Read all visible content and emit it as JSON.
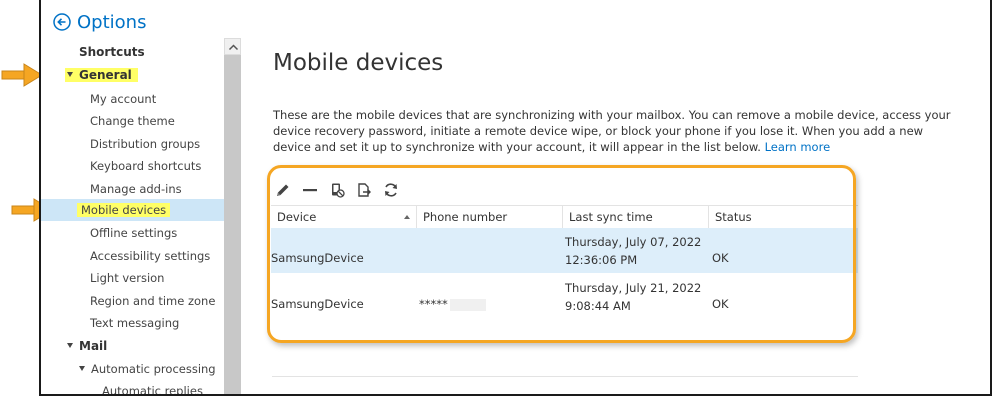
{
  "header": {
    "title": "Options"
  },
  "sidebar": {
    "items": [
      {
        "label": "Shortcuts",
        "kind": "category"
      },
      {
        "label": "General",
        "kind": "category-expanded"
      },
      {
        "label": "My account",
        "kind": "sub"
      },
      {
        "label": "Change theme",
        "kind": "sub"
      },
      {
        "label": "Distribution groups",
        "kind": "sub"
      },
      {
        "label": "Keyboard shortcuts",
        "kind": "sub"
      },
      {
        "label": "Manage add-ins",
        "kind": "sub"
      },
      {
        "label": "Mobile devices",
        "kind": "sub-selected"
      },
      {
        "label": "Offline settings",
        "kind": "sub"
      },
      {
        "label": "Accessibility settings",
        "kind": "sub"
      },
      {
        "label": "Light version",
        "kind": "sub"
      },
      {
        "label": "Region and time zone",
        "kind": "sub"
      },
      {
        "label": "Text messaging",
        "kind": "sub"
      },
      {
        "label": "Mail",
        "kind": "category-expanded"
      },
      {
        "label": "Automatic processing",
        "kind": "sub-expanded"
      },
      {
        "label": "Automatic replies",
        "kind": "subsub"
      }
    ]
  },
  "main": {
    "title": "Mobile devices",
    "description": "These are the mobile devices that are synchronizing with your mailbox. You can remove a mobile device, access your device recovery password, initiate a remote device wipe, or block your phone if you lose it. When you add a new device and set it up to synchronize with your account, it will appear in the list below.",
    "learn_more": "Learn more",
    "toolbar": {
      "icons": [
        "edit-icon",
        "remove-icon",
        "block-icon",
        "export-icon",
        "refresh-icon"
      ]
    },
    "table": {
      "columns": [
        "Device",
        "Phone number",
        "Last sync time",
        "Status"
      ],
      "rows": [
        {
          "device": "SamsungDevice",
          "phone": "",
          "sync_date": "Thursday, July 07, 2022",
          "sync_time": "12:36:06 PM",
          "status": "OK"
        },
        {
          "device": "SamsungDevice",
          "phone": "*****",
          "sync_date": "Thursday, July 21, 2022",
          "sync_time": "9:08:44 AM",
          "status": "OK"
        }
      ]
    }
  },
  "colors": {
    "accent": "#0072c6",
    "selection": "#cde6f7",
    "highlight": "#ffff66",
    "annotation": "#f5a623"
  }
}
